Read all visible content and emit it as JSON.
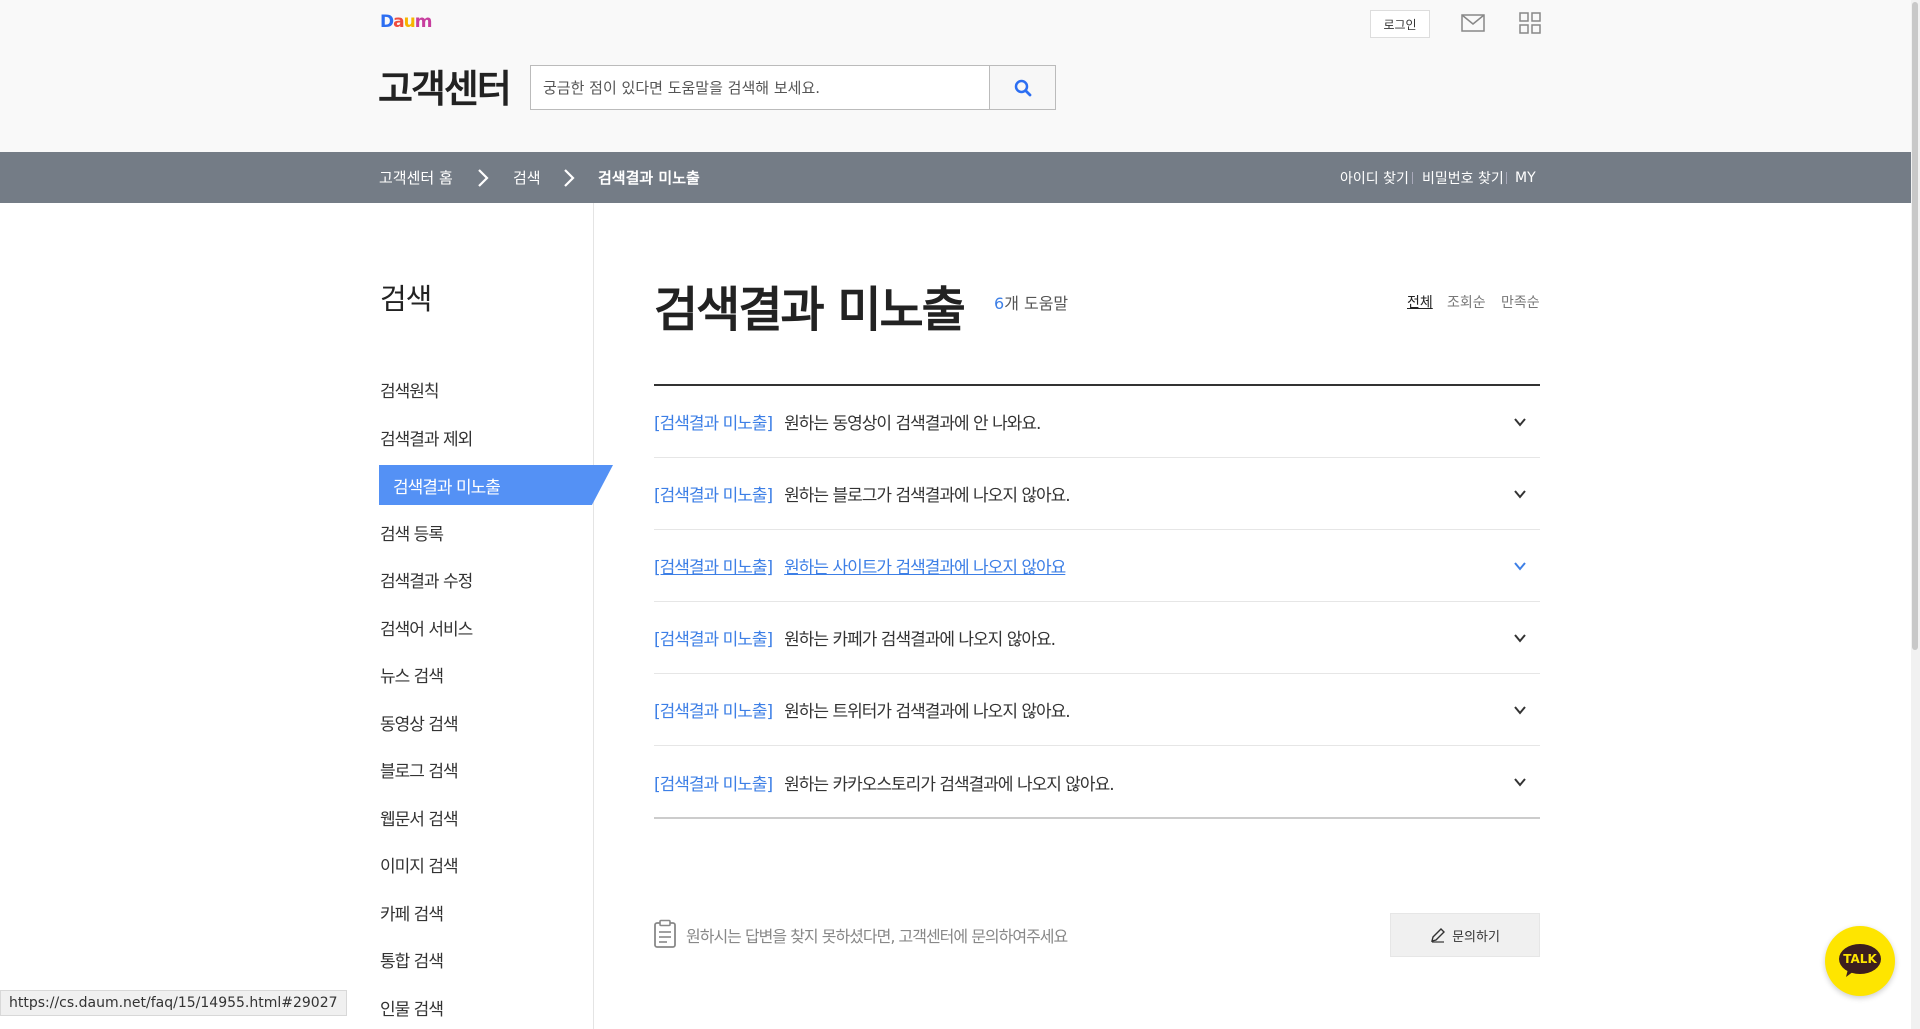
{
  "header": {
    "logo_letters": [
      "D",
      "a",
      "u",
      "m"
    ],
    "logo_colors": [
      "#2c6ef2",
      "#ef4c3f",
      "#f7b500",
      "#c73e9e"
    ],
    "login_label": "로그인",
    "site_title": "고객센터",
    "search_placeholder": "궁금한 점이 있다면 도움말을 검색해 보세요.",
    "icons": [
      "mail-icon",
      "apps-grid-icon",
      "search-icon"
    ]
  },
  "breadcrumb": {
    "items": [
      "고객센터 홈",
      "검색",
      "검색결과 미노출"
    ],
    "links": [
      "아이디 찾기",
      "비밀번호 찾기",
      "MY"
    ]
  },
  "sidebar": {
    "title": "검색",
    "items": [
      {
        "label": "검색원칙"
      },
      {
        "label": "검색결과 제외"
      },
      {
        "label": "검색결과 미노출",
        "active": true
      },
      {
        "label": "검색 등록"
      },
      {
        "label": "검색결과 수정"
      },
      {
        "label": "검색어 서비스"
      },
      {
        "label": "뉴스 검색"
      },
      {
        "label": "동영상 검색"
      },
      {
        "label": "블로그 검색"
      },
      {
        "label": "웹문서 검색"
      },
      {
        "label": "이미지 검색"
      },
      {
        "label": "카페 검색"
      },
      {
        "label": "통합 검색"
      },
      {
        "label": "인물 검색"
      }
    ]
  },
  "main": {
    "title": "검색결과 미노출",
    "count_num": "6",
    "count_suffix": "개 도움말",
    "sort": [
      "전체",
      "조회순",
      "만족순"
    ],
    "sort_active": "전체",
    "accent_color": "#3d7fe6",
    "faqs": [
      {
        "category": "[검색결과 미노출]",
        "question": "원하는 동영상이 검색결과에 안 나와요."
      },
      {
        "category": "[검색결과 미노출]",
        "question": "원하는 블로그가 검색결과에 나오지 않아요."
      },
      {
        "category": "[검색결과 미노출]",
        "question": "원하는 사이트가 검색결과에 나오지 않아요",
        "hovered": true
      },
      {
        "category": "[검색결과 미노출]",
        "question": "원하는 카페가 검색결과에 나오지 않아요."
      },
      {
        "category": "[검색결과 미노출]",
        "question": "원하는 트위터가 검색결과에 나오지 않아요."
      },
      {
        "category": "[검색결과 미노출]",
        "question": "원하는 카카오스토리가 검색결과에 나오지 않아요."
      }
    ]
  },
  "footer": {
    "help_text": "원하시는 답변을 찾지 못하셨다면, 고객센터에 문의하여주세요",
    "inquiry_label": "문의하기",
    "talk_label": "TALK"
  },
  "status_bar": {
    "url": "https://cs.daum.net/faq/15/14955.html#29027"
  }
}
